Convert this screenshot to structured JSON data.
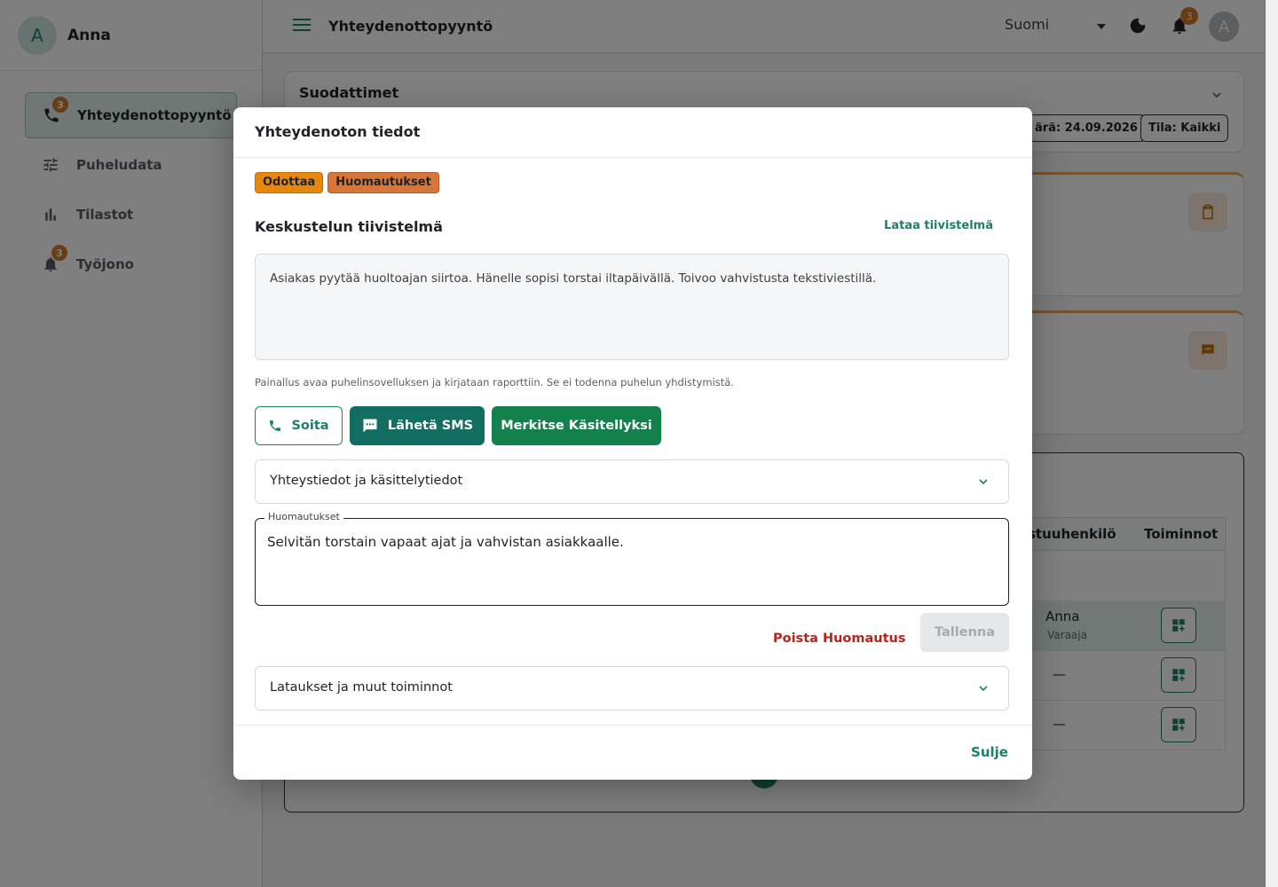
{
  "sidebar": {
    "user_initial": "A",
    "user_name": "Anna",
    "items": [
      {
        "label": "Yhteydenottopyyntö",
        "badge": "3"
      },
      {
        "label": "Puheludata"
      },
      {
        "label": "Tilastot"
      },
      {
        "label": "Työjono",
        "badge": "3"
      }
    ]
  },
  "topbar": {
    "title": "Yhteydenottopyyntö",
    "language": "Suomi",
    "notification_count": "3",
    "avatar_initial": "A"
  },
  "filters": {
    "title": "Suodattimet",
    "chip_date": "ärä: 24.09.2026",
    "chip_status": "Tila: Kaikki"
  },
  "table": {
    "col_person": "stuuhenkilö",
    "col_actions": "Toiminnot",
    "rows": [
      {
        "person": "Anna",
        "role": "Varaaja"
      },
      {
        "person": "—"
      },
      {
        "person": "—"
      }
    ]
  },
  "modal": {
    "title": "Yhteydenoton tiedot",
    "tags": [
      "Odottaa",
      "Huomautukset"
    ],
    "summary_title": "Keskustelun tiivistelmä",
    "download_summary": "Lataa tiivistelmä",
    "summary_text": "Asiakas pyytää huoltoajan siirtoa. Hänelle sopisi torstai iltapäivällä. Toivoo vahvistusta tekstiviestillä.",
    "hint": "Painallus avaa puhelinsovelluksen ja kirjataan raporttiin. Se ei todenna puhelun yhdistymistä.",
    "call_label": "Soita",
    "sms_label": "Lähetä SMS",
    "mark_handled_label": "Merkitse Käsitellyksi",
    "accordion_contact": "Yhteystiedot ja käsittelytiedot",
    "notes_label": "Huomautukset",
    "notes_value": "Selvitän torstain vapaat ajat ja vahvistan asiakkaalle.",
    "delete_note_label": "Poista Huomautus",
    "save_label": "Tallenna",
    "accordion_downloads": "Lataukset ja muut toiminnot",
    "close_label": "Sulje"
  }
}
